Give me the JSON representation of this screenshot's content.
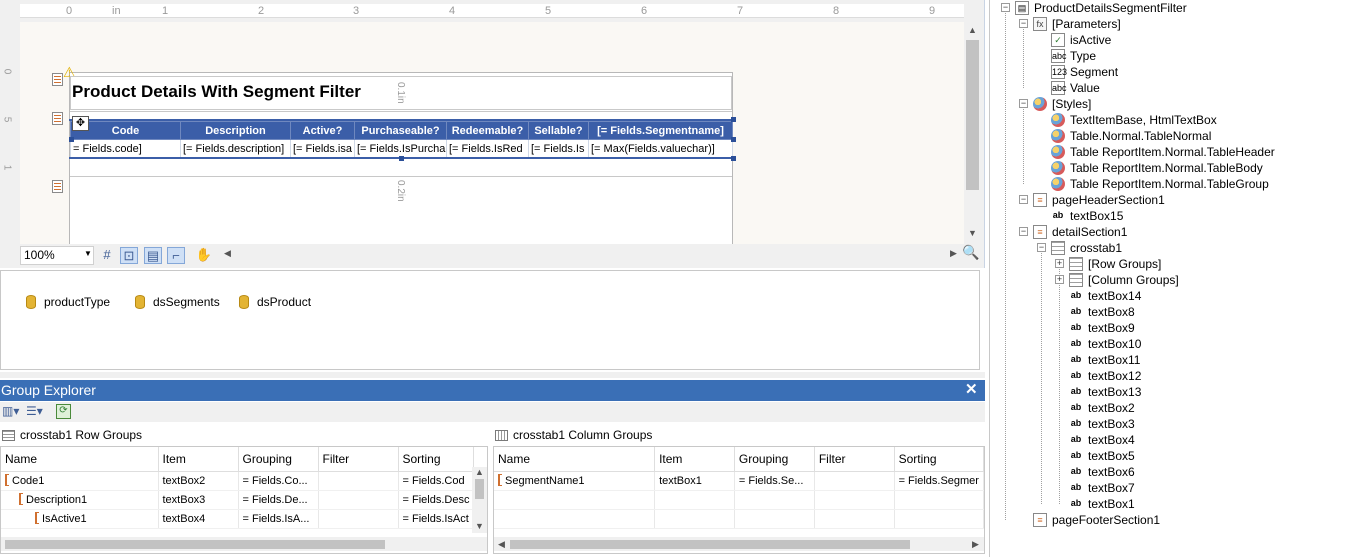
{
  "designer": {
    "ruler_labels": [
      "0",
      "in",
      "1",
      "2",
      "3",
      "4",
      "5",
      "6",
      "7",
      "8",
      "9"
    ],
    "vertical_ruler_labels": [
      "0",
      "5",
      "1"
    ],
    "report_title": "Product Details With Segment Filter",
    "section_marker_top": "0.1in",
    "section_marker_bottom": "0.2in",
    "crosstab_headers": [
      "Code",
      "Description",
      "Active?",
      "Purchaseable?",
      "Redeemable?",
      "Sellable?",
      "[= Fields.Segmentname]"
    ],
    "crosstab_cells": [
      "= Fields.code]",
      "[= Fields.description]",
      "[= Fields.isa",
      "[= Fields.IsPurcha",
      "[= Fields.IsRed",
      "[= Fields.Is",
      "[= Max(Fields.valuechar)]"
    ],
    "zoom": "100%"
  },
  "datasources": [
    "productType",
    "dsSegments",
    "dsProduct"
  ],
  "group_explorer": {
    "title": "Group Explorer",
    "close_glyph": "✕",
    "row_groups": {
      "title": "crosstab1 Row Groups",
      "columns": [
        "Name",
        "Item",
        "Grouping",
        "Filter",
        "Sorting"
      ],
      "rows": [
        {
          "name": "Code1",
          "item": "textBox2",
          "grouping": "= Fields.Co...",
          "filter": "",
          "sorting": "= Fields.Cod"
        },
        {
          "name": "Description1",
          "item": "textBox3",
          "grouping": "= Fields.De...",
          "filter": "",
          "sorting": "= Fields.Desc"
        },
        {
          "name": "IsActive1",
          "item": "textBox4",
          "grouping": "= Fields.IsA...",
          "filter": "",
          "sorting": "= Fields.IsAct"
        }
      ]
    },
    "column_groups": {
      "title": "crosstab1 Column Groups",
      "columns": [
        "Name",
        "Item",
        "Grouping",
        "Filter",
        "Sorting"
      ],
      "rows": [
        {
          "name": "SegmentName1",
          "item": "textBox1",
          "grouping": "= Fields.Se...",
          "filter": "",
          "sorting": "= Fields.Segmer"
        }
      ]
    }
  },
  "report_tree": {
    "root": "ProductDetailsSegmentFilter",
    "parameters_label": "[Parameters]",
    "parameters": [
      "isActive",
      "Type",
      "Segment",
      "Value"
    ],
    "styles_label": "[Styles]",
    "styles": [
      "TextItemBase, HtmlTextBox",
      "Table.Normal.TableNormal",
      "Table ReportItem.Normal.TableHeader",
      "Table ReportItem.Normal.TableBody",
      "Table ReportItem.Normal.TableGroup"
    ],
    "page_header": "pageHeaderSection1",
    "page_header_items": [
      "textBox15"
    ],
    "detail": "detailSection1",
    "crosstab": "crosstab1",
    "row_groups": "[Row Groups]",
    "column_groups": "[Column Groups]",
    "crosstab_items": [
      "textBox14",
      "textBox8",
      "textBox9",
      "textBox10",
      "textBox11",
      "textBox12",
      "textBox13",
      "textBox2",
      "textBox3",
      "textBox4",
      "textBox5",
      "textBox6",
      "textBox7",
      "textBox1"
    ],
    "page_footer": "pageFooterSection1"
  },
  "colors": {
    "accent": "#3a6fb6",
    "crosstab_header": "#3b5ea8"
  }
}
